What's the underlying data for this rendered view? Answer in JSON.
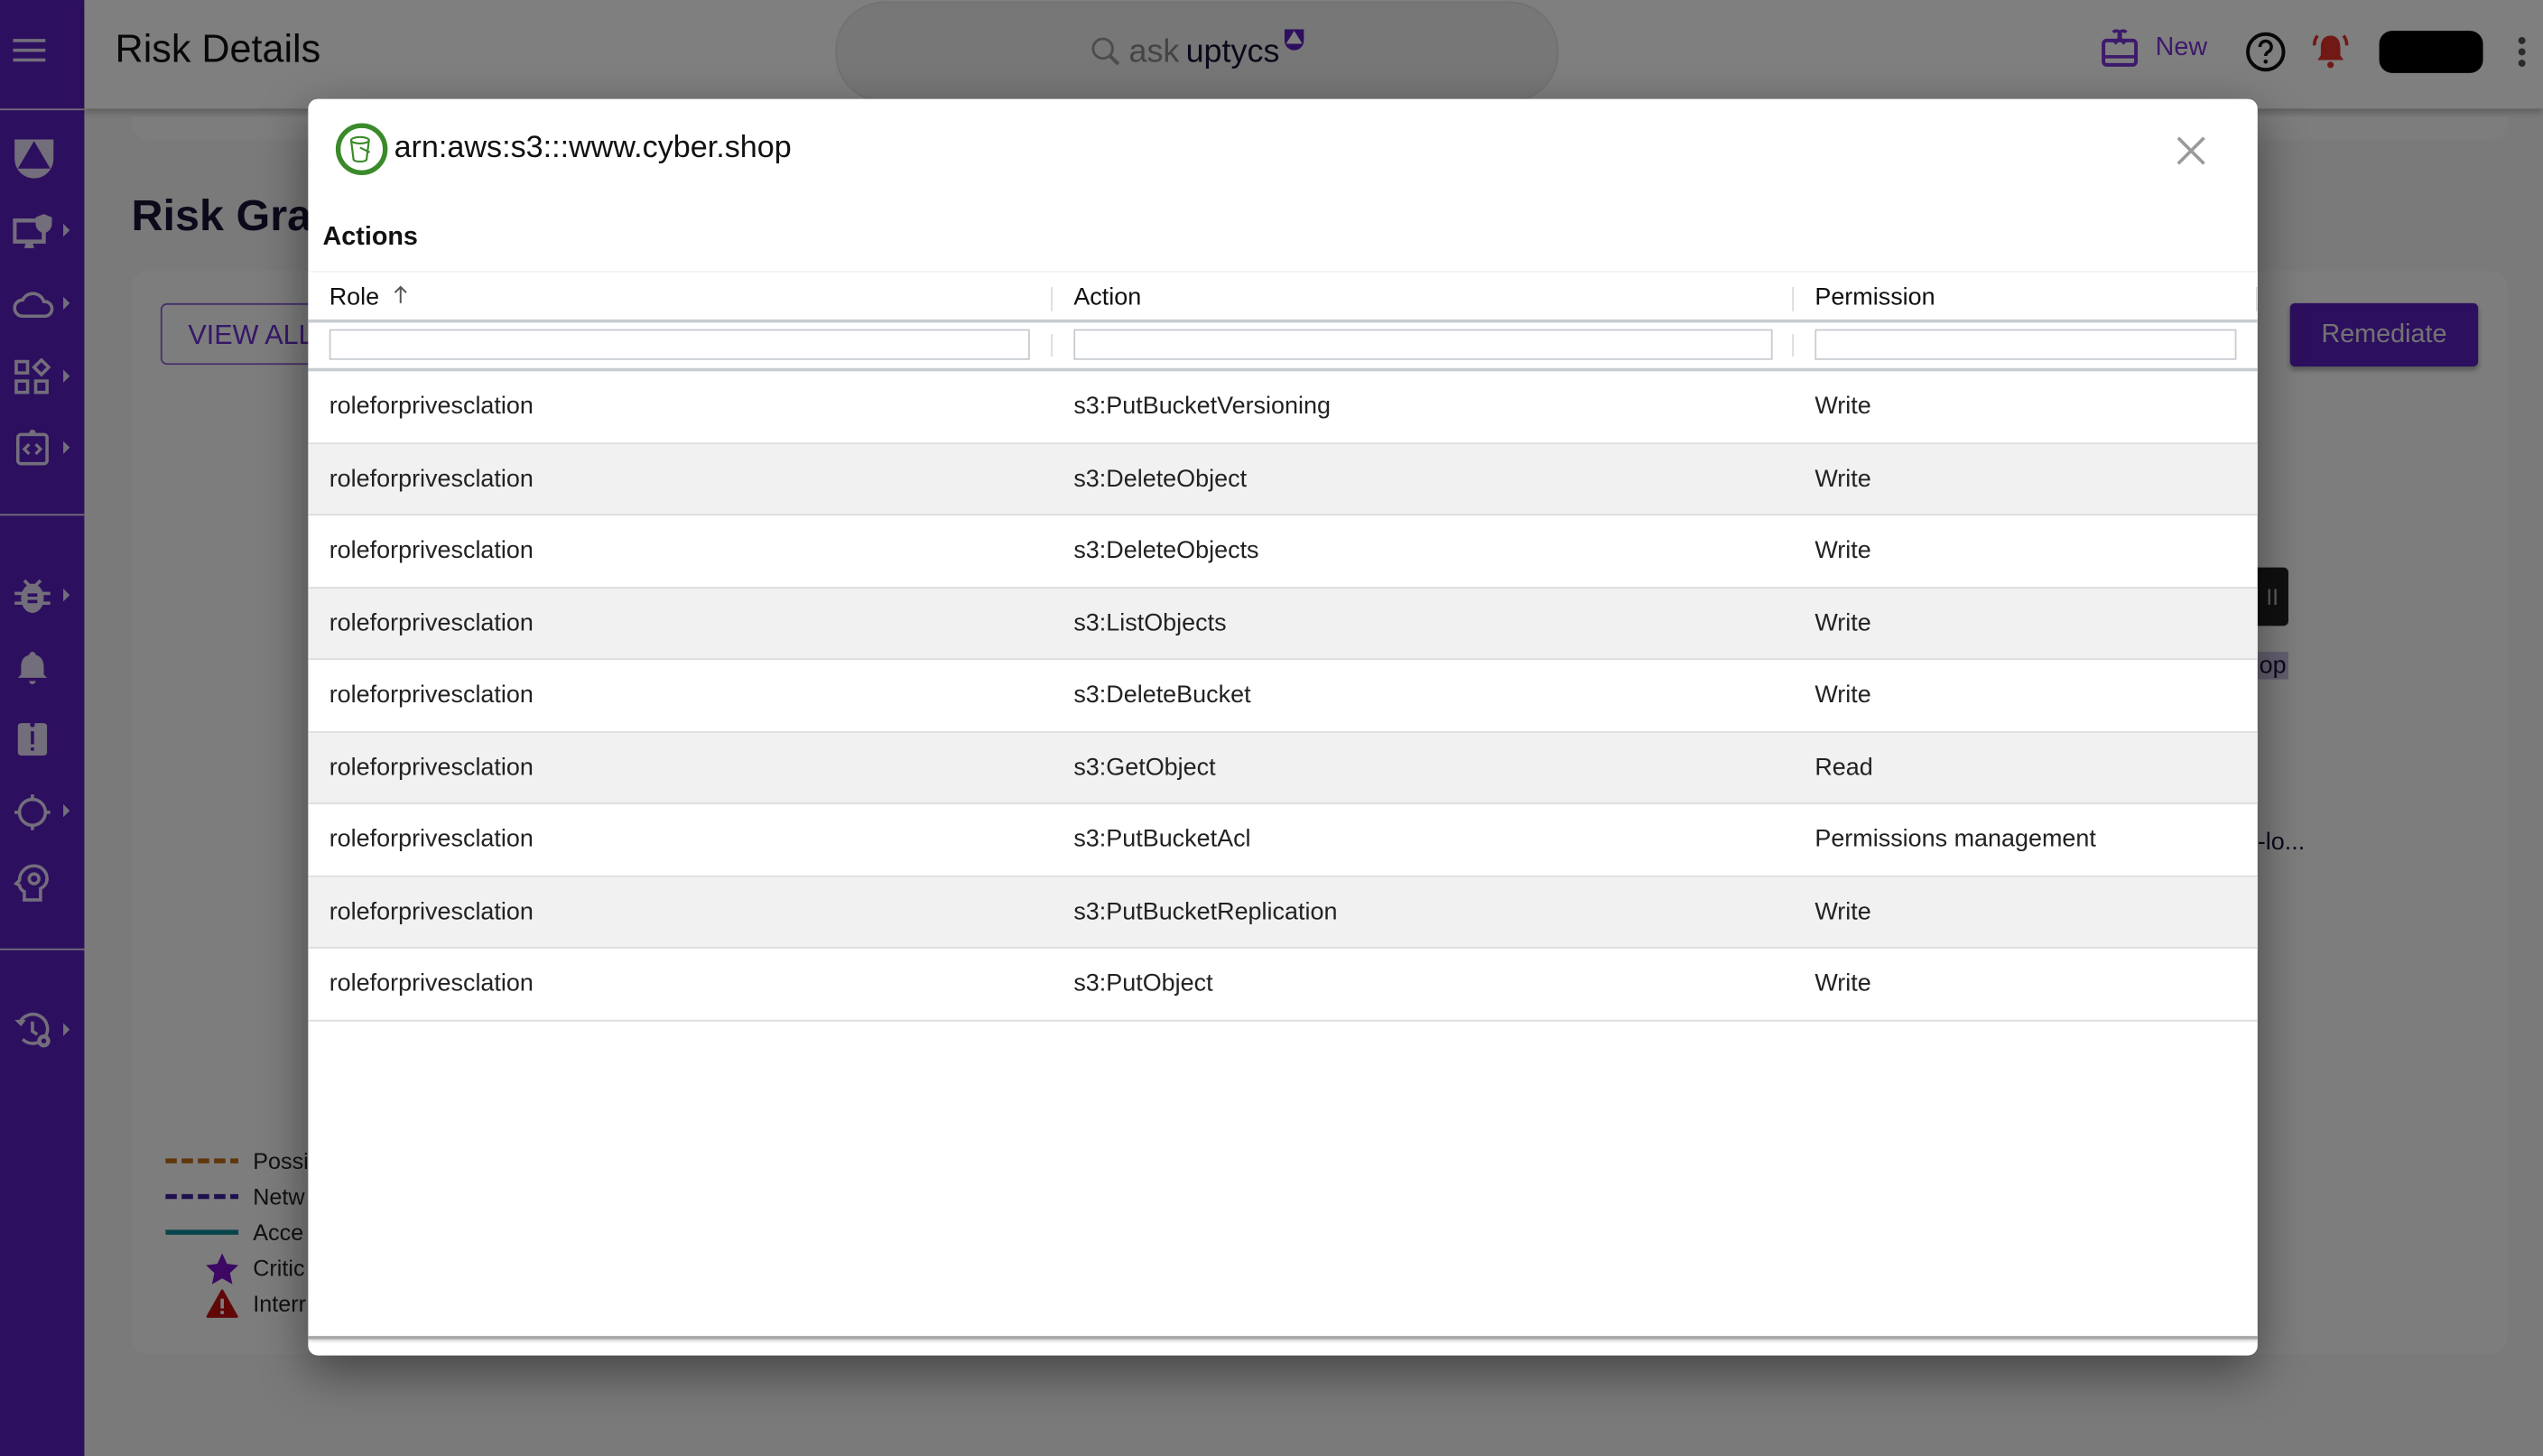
{
  "app": {
    "page_title": "Risk Details",
    "search": {
      "ask_label": "ask",
      "brand_label": "uptycs"
    },
    "header": {
      "new_label": "New"
    },
    "colors": {
      "brand_purple": "#5b1fbf",
      "alert_red": "#c0261e",
      "resource_green": "#3b8a2a"
    }
  },
  "sidebar": {
    "items": [
      {
        "icon": "uptycs-logo-icon",
        "has_submenu": false
      },
      {
        "icon": "monitor-shield-icon",
        "has_submenu": true
      },
      {
        "icon": "cloud-icon",
        "has_submenu": true
      },
      {
        "icon": "apps-grid-icon",
        "has_submenu": true
      },
      {
        "icon": "code-clipboard-icon",
        "has_submenu": true
      },
      {
        "icon": "bug-icon",
        "has_submenu": true
      },
      {
        "icon": "bell-icon",
        "has_submenu": false
      },
      {
        "icon": "alert-clipboard-icon",
        "has_submenu": false
      },
      {
        "icon": "crosshair-icon",
        "has_submenu": true
      },
      {
        "icon": "head-gear-icon",
        "has_submenu": false
      },
      {
        "icon": "history-settings-icon",
        "has_submenu": true
      }
    ]
  },
  "background": {
    "section_title": "Risk Gra",
    "view_all_label": "VIEW ALL",
    "remediate_label": "Remediate",
    "node_chip_text": "II",
    "node_label_1": "op",
    "node_label_2": "-lo...",
    "legend": [
      {
        "label": "Possi",
        "style": "dashed",
        "color": "#c06a10"
      },
      {
        "label": "Netw",
        "style": "dashed",
        "color": "#3f1f9a"
      },
      {
        "label": "Acce",
        "style": "solid",
        "color": "#0e8a99"
      },
      {
        "label": "Critic",
        "icon": "star-icon",
        "color": "#7a10c8"
      },
      {
        "label": "Interr",
        "icon": "warning-icon",
        "color": "#c0100f"
      }
    ]
  },
  "modal": {
    "title": "arn:aws:s3:::www.cyber.shop",
    "resource_icon": "s3-bucket-icon",
    "section_label": "Actions",
    "columns": [
      {
        "label": "Role",
        "sort": "ascending"
      },
      {
        "label": "Action"
      },
      {
        "label": "Permission"
      }
    ],
    "filters": {
      "role": "",
      "action": "",
      "permission": ""
    },
    "rows": [
      {
        "role": "roleforprivesclation",
        "action": "s3:PutBucketVersioning",
        "permission": "Write"
      },
      {
        "role": "roleforprivesclation",
        "action": "s3:DeleteObject",
        "permission": "Write"
      },
      {
        "role": "roleforprivesclation",
        "action": "s3:DeleteObjects",
        "permission": "Write"
      },
      {
        "role": "roleforprivesclation",
        "action": "s3:ListObjects",
        "permission": "Write"
      },
      {
        "role": "roleforprivesclation",
        "action": "s3:DeleteBucket",
        "permission": "Write"
      },
      {
        "role": "roleforprivesclation",
        "action": "s3:GetObject",
        "permission": "Read"
      },
      {
        "role": "roleforprivesclation",
        "action": "s3:PutBucketAcl",
        "permission": "Permissions management"
      },
      {
        "role": "roleforprivesclation",
        "action": "s3:PutBucketReplication",
        "permission": "Write"
      },
      {
        "role": "roleforprivesclation",
        "action": "s3:PutObject",
        "permission": "Write"
      }
    ]
  }
}
